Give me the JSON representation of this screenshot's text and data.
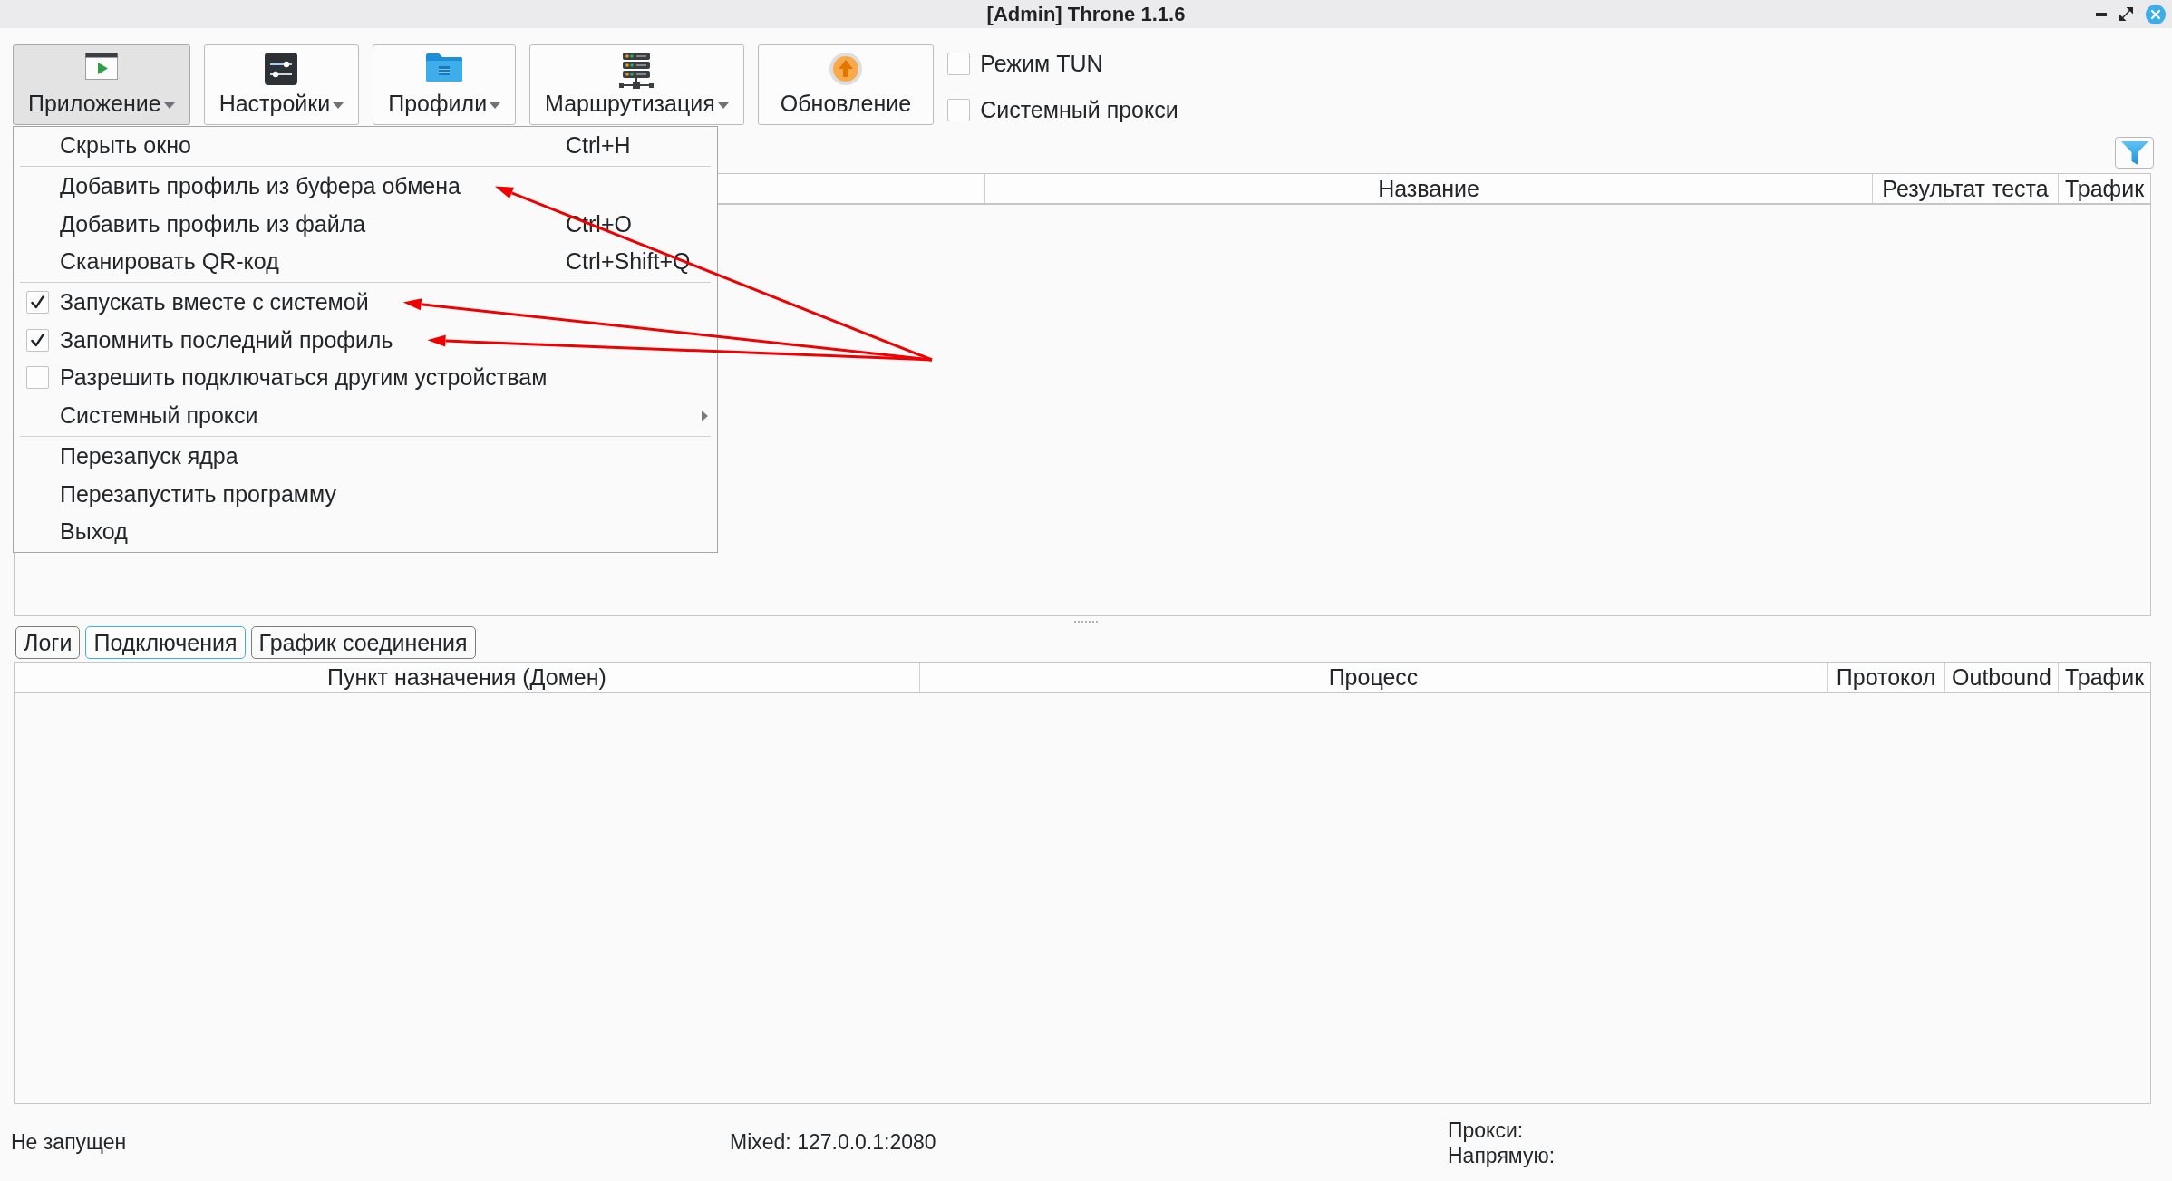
{
  "window": {
    "title": "[Admin] Throne 1.1.6"
  },
  "toolbar": {
    "buttons": [
      {
        "label": "Приложение",
        "dropdown": true,
        "selected": true
      },
      {
        "label": "Настройки",
        "dropdown": true,
        "selected": false
      },
      {
        "label": "Профили",
        "dropdown": true,
        "selected": false
      },
      {
        "label": "Маршрутизация",
        "dropdown": true,
        "selected": false
      },
      {
        "label": "Обновление",
        "dropdown": false,
        "selected": false
      }
    ],
    "checkboxes": [
      {
        "label": "Режим TUN",
        "checked": false
      },
      {
        "label": "Системный прокси",
        "checked": false
      }
    ]
  },
  "app_menu": {
    "items": [
      {
        "kind": "action",
        "label": "Скрыть окно",
        "shortcut": "Ctrl+H",
        "marked_by_arrow": false
      },
      {
        "kind": "separator"
      },
      {
        "kind": "action",
        "label": "Добавить профиль из буфера обмена",
        "marked_by_arrow": true
      },
      {
        "kind": "action",
        "label": "Добавить профиль из файла",
        "shortcut": "Ctrl+O",
        "marked_by_arrow": false
      },
      {
        "kind": "action",
        "label": "Сканировать QR-код",
        "shortcut": "Ctrl+Shift+Q",
        "marked_by_arrow": false
      },
      {
        "kind": "separator"
      },
      {
        "kind": "check",
        "label": "Запускать вместе с системой",
        "checked": true,
        "marked_by_arrow": true
      },
      {
        "kind": "check",
        "label": "Запомнить последний профиль",
        "checked": true,
        "marked_by_arrow": true
      },
      {
        "kind": "check",
        "label": "Разрешить подключаться другим устройствам",
        "checked": false,
        "marked_by_arrow": false
      },
      {
        "kind": "submenu",
        "label": "Системный прокси",
        "marked_by_arrow": false
      },
      {
        "kind": "separator"
      },
      {
        "kind": "action",
        "label": "Перезапуск ядра",
        "marked_by_arrow": false
      },
      {
        "kind": "action",
        "label": "Перезапустить программу",
        "marked_by_arrow": false
      },
      {
        "kind": "action",
        "label": "Выход",
        "marked_by_arrow": false
      }
    ]
  },
  "profiles_table": {
    "columns": [
      "Название",
      "Результат теста",
      "Трафик"
    ]
  },
  "connection_tabs": [
    {
      "label": "Логи",
      "selected": false
    },
    {
      "label": "Подключения",
      "selected": true
    },
    {
      "label": "График соединения",
      "selected": false
    }
  ],
  "connections_table": {
    "columns": [
      "Пункт назначения (Домен)",
      "Процесс",
      "Протокол",
      "Outbound",
      "Трафик"
    ]
  },
  "status_bar": {
    "state": "Не запущен",
    "listen_address": "Mixed: 127.0.0.1:2080",
    "proxy_label": "Прокси:",
    "direct_label": "Напрямую:"
  }
}
